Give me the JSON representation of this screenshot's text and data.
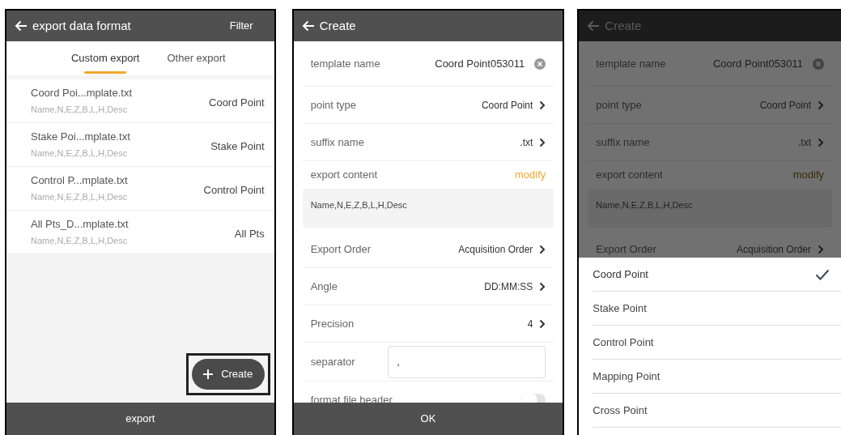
{
  "list_screen": {
    "title": "export data format",
    "action": "Filter",
    "tabs": [
      {
        "label": "Custom export",
        "selected": true
      },
      {
        "label": "Other export",
        "selected": false
      }
    ],
    "templates": [
      {
        "name": "Coord Poi...mplate.txt",
        "fields": "Name,N,E,Z,B,L,H,Desc",
        "point_type": "Coord Point"
      },
      {
        "name": "Stake Poi...mplate.txt",
        "fields": "Name,N,E,Z,B,L,H,Desc",
        "point_type": "Stake Point"
      },
      {
        "name": "Control P...mplate.txt",
        "fields": "Name,N,E,Z,B,L,H,Desc",
        "point_type": "Control Point"
      },
      {
        "name": "All Pts_D...mplate.txt",
        "fields": "Name,N,E,Z,B,L,H,Desc",
        "point_type": "All Pts"
      }
    ],
    "create_button": "Create",
    "bottom_button": "export"
  },
  "create_screen": {
    "title": "Create",
    "rows": [
      {
        "kind": "clearable",
        "label": "template name",
        "value": "Coord Point053011"
      },
      {
        "kind": "select",
        "label": "point type",
        "value": "Coord Point"
      },
      {
        "kind": "select",
        "label": "suffix name",
        "value": ".txt"
      },
      {
        "kind": "content",
        "label": "export content",
        "action": "modify",
        "value": "Name,N,E,Z,B,L,H,Desc"
      },
      {
        "kind": "select",
        "label": "Export Order",
        "value": "Acquisition Order"
      },
      {
        "kind": "select",
        "label": "Angle",
        "value": "DD:MM:SS"
      },
      {
        "kind": "select",
        "label": "Precision",
        "value": "4"
      },
      {
        "kind": "input",
        "label": "separator",
        "value": ","
      },
      {
        "kind": "toggle",
        "label": "format file header",
        "on": false
      }
    ],
    "ok_button": "OK"
  },
  "point_type_picker": {
    "title": "Create",
    "rows": [
      {
        "kind": "clearable",
        "label": "template name",
        "value": "Coord Point053011"
      },
      {
        "kind": "select",
        "label": "point type",
        "value": "Coord Point"
      },
      {
        "kind": "select",
        "label": "suffix name",
        "value": ".txt"
      },
      {
        "kind": "content",
        "label": "export content",
        "action": "modify",
        "value": "Name,N,E,Z,B,L,H,Desc"
      },
      {
        "kind": "select",
        "label": "Export Order",
        "value": "Acquisition Order"
      }
    ],
    "options": [
      {
        "label": "Coord Point",
        "selected": true
      },
      {
        "label": "Stake Point",
        "selected": false
      },
      {
        "label": "Control Point",
        "selected": false
      },
      {
        "label": "Mapping Point",
        "selected": false
      },
      {
        "label": "Cross Point",
        "selected": false
      }
    ]
  }
}
